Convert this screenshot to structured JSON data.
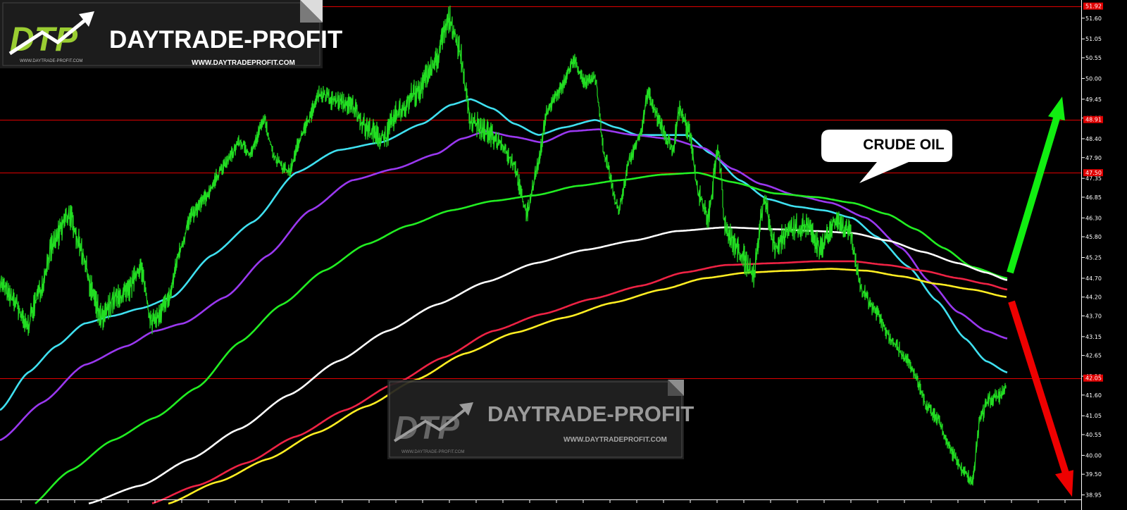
{
  "chart_data": {
    "type": "line",
    "title": "CRUDE OIL",
    "ylim": [
      38.68,
      52.05
    ],
    "y_ticks": [
      "51.60",
      "51.05",
      "50.55",
      "50.00",
      "49.45",
      "48.95",
      "48.40",
      "47.90",
      "47.35",
      "46.85",
      "46.30",
      "45.80",
      "45.25",
      "44.70",
      "44.20",
      "43.70",
      "43.15",
      "42.65",
      "42.10",
      "41.60",
      "41.05",
      "40.55",
      "40.00",
      "39.50",
      "38.95"
    ],
    "horizontal_levels": [
      {
        "value": 51.92,
        "label": "51.92",
        "color": "#e00000"
      },
      {
        "value": 48.91,
        "label": "48.91",
        "color": "#e00000"
      },
      {
        "value": 47.5,
        "label": "47.50",
        "color": "#e00000"
      },
      {
        "value": 42.05,
        "label": "42.05",
        "color": "#e00000"
      }
    ],
    "price_series": {
      "name": "price",
      "color": "#22dd22",
      "anchors": [
        [
          0,
          44.6
        ],
        [
          20,
          44.1
        ],
        [
          38,
          43.4
        ],
        [
          55,
          44.3
        ],
        [
          75,
          45.6
        ],
        [
          98,
          46.4
        ],
        [
          115,
          45.5
        ],
        [
          130,
          44.4
        ],
        [
          145,
          43.6
        ],
        [
          160,
          44.1
        ],
        [
          180,
          44.3
        ],
        [
          200,
          45.0
        ],
        [
          215,
          43.5
        ],
        [
          225,
          43.7
        ],
        [
          240,
          44.2
        ],
        [
          255,
          45.4
        ],
        [
          270,
          46.3
        ],
        [
          290,
          46.8
        ],
        [
          315,
          47.6
        ],
        [
          340,
          48.3
        ],
        [
          355,
          48.0
        ],
        [
          375,
          48.9
        ],
        [
          390,
          47.9
        ],
        [
          410,
          47.5
        ],
        [
          430,
          48.6
        ],
        [
          455,
          49.6
        ],
        [
          475,
          49.4
        ],
        [
          500,
          49.3
        ],
        [
          520,
          48.7
        ],
        [
          545,
          48.4
        ],
        [
          565,
          49.1
        ],
        [
          590,
          49.6
        ],
        [
          615,
          50.3
        ],
        [
          638,
          51.6
        ],
        [
          652,
          50.8
        ],
        [
          668,
          48.9
        ],
        [
          690,
          48.6
        ],
        [
          710,
          48.3
        ],
        [
          728,
          47.8
        ],
        [
          748,
          46.4
        ],
        [
          762,
          47.6
        ],
        [
          778,
          49.2
        ],
        [
          795,
          49.7
        ],
        [
          815,
          50.5
        ],
        [
          830,
          49.9
        ],
        [
          845,
          50.0
        ],
        [
          858,
          48.0
        ],
        [
          878,
          46.5
        ],
        [
          895,
          47.9
        ],
        [
          910,
          48.6
        ],
        [
          920,
          49.6
        ],
        [
          935,
          48.9
        ],
        [
          955,
          48.1
        ],
        [
          965,
          49.2
        ],
        [
          978,
          48.6
        ],
        [
          992,
          46.9
        ],
        [
          1005,
          46.3
        ],
        [
          1020,
          48.1
        ],
        [
          1030,
          46.0
        ],
        [
          1050,
          45.4
        ],
        [
          1070,
          44.8
        ],
        [
          1085,
          46.8
        ],
        [
          1100,
          45.5
        ],
        [
          1120,
          46.0
        ],
        [
          1145,
          46.1
        ],
        [
          1165,
          45.5
        ],
        [
          1185,
          46.2
        ],
        [
          1205,
          46.0
        ],
        [
          1225,
          44.3
        ],
        [
          1245,
          43.8
        ],
        [
          1265,
          43.1
        ],
        [
          1285,
          42.6
        ],
        [
          1300,
          42.1
        ],
        [
          1315,
          41.3
        ],
        [
          1330,
          41.0
        ],
        [
          1350,
          40.1
        ],
        [
          1370,
          39.5
        ],
        [
          1380,
          39.3
        ],
        [
          1392,
          41.0
        ],
        [
          1405,
          41.5
        ],
        [
          1418,
          41.6
        ],
        [
          1428,
          41.8
        ]
      ]
    },
    "moving_averages": [
      {
        "color": "#3fe0f0",
        "anchors": [
          [
            0,
            41.2
          ],
          [
            40,
            42.2
          ],
          [
            80,
            42.9
          ],
          [
            120,
            43.5
          ],
          [
            160,
            43.7
          ],
          [
            200,
            43.9
          ],
          [
            245,
            44.2
          ],
          [
            300,
            45.3
          ],
          [
            360,
            46.2
          ],
          [
            420,
            47.5
          ],
          [
            480,
            48.1
          ],
          [
            540,
            48.3
          ],
          [
            600,
            48.8
          ],
          [
            640,
            49.3
          ],
          [
            668,
            49.45
          ],
          [
            700,
            49.2
          ],
          [
            730,
            48.8
          ],
          [
            765,
            48.5
          ],
          [
            800,
            48.7
          ],
          [
            845,
            48.9
          ],
          [
            875,
            48.7
          ],
          [
            905,
            48.5
          ],
          [
            940,
            48.5
          ],
          [
            975,
            48.5
          ],
          [
            1010,
            48.0
          ],
          [
            1050,
            47.3
          ],
          [
            1090,
            46.8
          ],
          [
            1130,
            46.6
          ],
          [
            1170,
            46.5
          ],
          [
            1210,
            46.3
          ],
          [
            1245,
            45.8
          ],
          [
            1290,
            45.0
          ],
          [
            1330,
            44.1
          ],
          [
            1370,
            43.1
          ],
          [
            1400,
            42.5
          ],
          [
            1430,
            42.2
          ]
        ]
      },
      {
        "color": "#9a38f0",
        "anchors": [
          [
            0,
            40.4
          ],
          [
            60,
            41.4
          ],
          [
            120,
            42.4
          ],
          [
            180,
            42.9
          ],
          [
            220,
            43.3
          ],
          [
            260,
            43.5
          ],
          [
            320,
            44.2
          ],
          [
            380,
            45.3
          ],
          [
            440,
            46.5
          ],
          [
            500,
            47.3
          ],
          [
            560,
            47.6
          ],
          [
            620,
            48.0
          ],
          [
            655,
            48.4
          ],
          [
            690,
            48.6
          ],
          [
            730,
            48.45
          ],
          [
            770,
            48.3
          ],
          [
            810,
            48.6
          ],
          [
            850,
            48.65
          ],
          [
            900,
            48.5
          ],
          [
            950,
            48.4
          ],
          [
            1000,
            48.15
          ],
          [
            1040,
            47.6
          ],
          [
            1080,
            47.2
          ],
          [
            1130,
            46.9
          ],
          [
            1180,
            46.7
          ],
          [
            1230,
            46.3
          ],
          [
            1280,
            45.5
          ],
          [
            1320,
            44.6
          ],
          [
            1360,
            43.8
          ],
          [
            1400,
            43.3
          ],
          [
            1430,
            43.1
          ]
        ]
      },
      {
        "color": "#22ee22",
        "anchors": [
          [
            40,
            38.6
          ],
          [
            100,
            39.6
          ],
          [
            160,
            40.4
          ],
          [
            220,
            41.0
          ],
          [
            280,
            41.8
          ],
          [
            340,
            43.0
          ],
          [
            400,
            44.0
          ],
          [
            460,
            44.9
          ],
          [
            520,
            45.6
          ],
          [
            580,
            46.1
          ],
          [
            640,
            46.5
          ],
          [
            700,
            46.75
          ],
          [
            760,
            46.9
          ],
          [
            820,
            47.15
          ],
          [
            880,
            47.3
          ],
          [
            940,
            47.45
          ],
          [
            990,
            47.5
          ],
          [
            1040,
            47.25
          ],
          [
            1100,
            46.95
          ],
          [
            1160,
            46.85
          ],
          [
            1210,
            46.7
          ],
          [
            1260,
            46.4
          ],
          [
            1300,
            46.0
          ],
          [
            1340,
            45.5
          ],
          [
            1380,
            45.0
          ],
          [
            1430,
            44.7
          ]
        ]
      },
      {
        "color": "#ffffff",
        "anchors": [
          [
            120,
            38.7
          ],
          [
            200,
            39.2
          ],
          [
            270,
            39.9
          ],
          [
            340,
            40.7
          ],
          [
            410,
            41.6
          ],
          [
            480,
            42.5
          ],
          [
            550,
            43.3
          ],
          [
            620,
            44.0
          ],
          [
            690,
            44.6
          ],
          [
            760,
            45.1
          ],
          [
            830,
            45.45
          ],
          [
            900,
            45.7
          ],
          [
            960,
            45.95
          ],
          [
            1030,
            46.05
          ],
          [
            1100,
            46.0
          ],
          [
            1160,
            45.95
          ],
          [
            1210,
            45.9
          ],
          [
            1260,
            45.7
          ],
          [
            1310,
            45.4
          ],
          [
            1360,
            45.1
          ],
          [
            1400,
            44.85
          ],
          [
            1430,
            44.65
          ]
        ]
      },
      {
        "color": "#ee2244",
        "anchors": [
          [
            210,
            38.7
          ],
          [
            280,
            39.2
          ],
          [
            350,
            39.8
          ],
          [
            420,
            40.5
          ],
          [
            490,
            41.2
          ],
          [
            560,
            41.9
          ],
          [
            630,
            42.6
          ],
          [
            700,
            43.3
          ],
          [
            770,
            43.75
          ],
          [
            840,
            44.15
          ],
          [
            910,
            44.5
          ],
          [
            970,
            44.85
          ],
          [
            1030,
            45.05
          ],
          [
            1100,
            45.1
          ],
          [
            1160,
            45.15
          ],
          [
            1210,
            45.15
          ],
          [
            1260,
            45.05
          ],
          [
            1310,
            44.9
          ],
          [
            1360,
            44.7
          ],
          [
            1400,
            44.55
          ],
          [
            1430,
            44.4
          ]
        ]
      },
      {
        "color": "#ffee22",
        "anchors": [
          [
            235,
            38.7
          ],
          [
            310,
            39.3
          ],
          [
            380,
            39.9
          ],
          [
            450,
            40.6
          ],
          [
            520,
            41.3
          ],
          [
            590,
            42.0
          ],
          [
            660,
            42.7
          ],
          [
            730,
            43.25
          ],
          [
            800,
            43.65
          ],
          [
            870,
            44.05
          ],
          [
            940,
            44.4
          ],
          [
            1000,
            44.7
          ],
          [
            1060,
            44.85
          ],
          [
            1120,
            44.9
          ],
          [
            1180,
            44.95
          ],
          [
            1230,
            44.9
          ],
          [
            1280,
            44.75
          ],
          [
            1330,
            44.55
          ],
          [
            1380,
            44.4
          ],
          [
            1430,
            44.2
          ]
        ]
      }
    ],
    "arrows": [
      {
        "color": "#11ee11",
        "direction": "up",
        "from_value": 44.85,
        "to_value": 49.52
      },
      {
        "color": "#ee0000",
        "direction": "down",
        "from_value": 44.08,
        "to_value": 38.9
      }
    ]
  },
  "annotation": {
    "bubble_text": "CRUDE OIL"
  },
  "logos": {
    "top": {
      "mark": "DTP",
      "name": "DAYTRADE-PROFIT",
      "url": "WWW.DAYTRADEPROFIT.COM",
      "small_url": "WWW.DAYTRADE-PROFIT.COM"
    },
    "center": {
      "mark": "DTP",
      "name": "DAYTRADE-PROFIT",
      "url": "WWW.DAYTRADEPROFIT.COM",
      "small_url": "WWW.DAYTRADE-PROFIT.COM"
    }
  }
}
